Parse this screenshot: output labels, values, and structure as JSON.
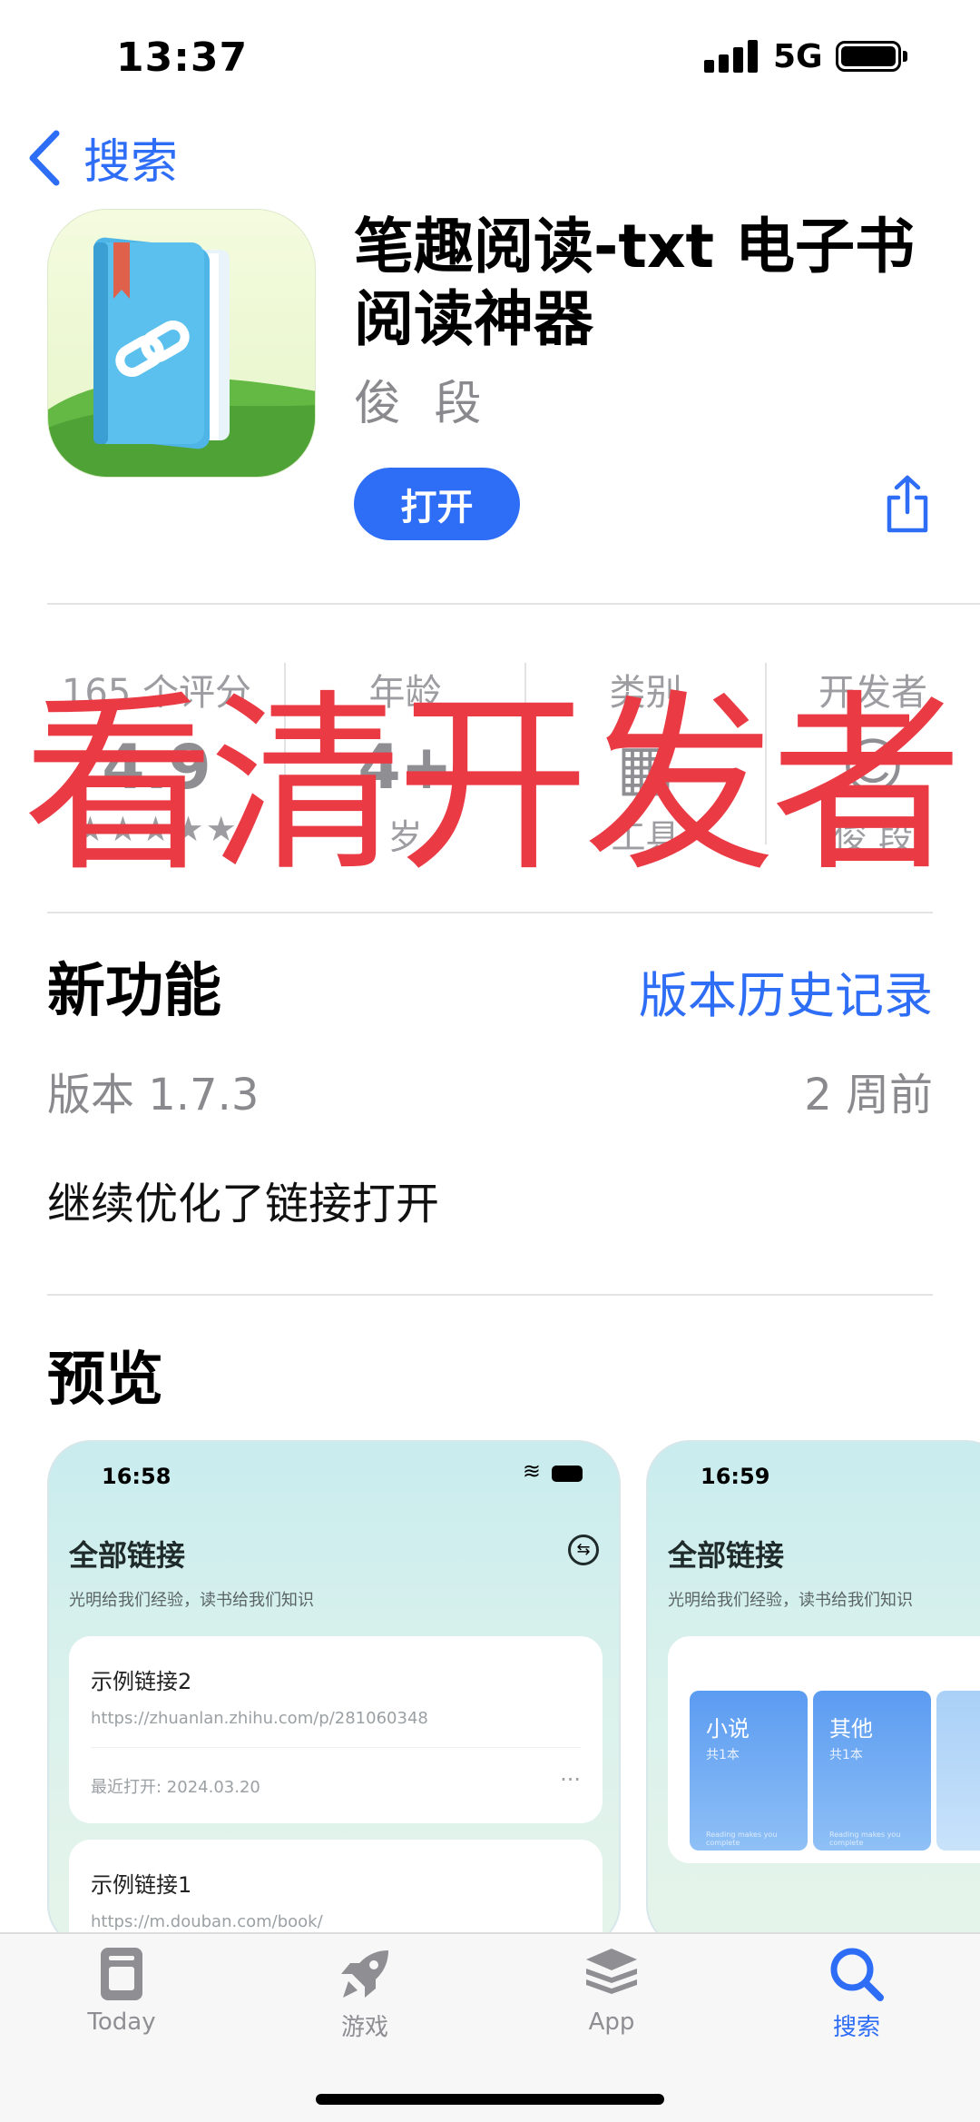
{
  "status_bar": {
    "time": "13:37",
    "network": "5G"
  },
  "nav": {
    "back_label": "搜索"
  },
  "app": {
    "title": "笔趣阅读-txt 电子书阅读神器",
    "developer": "俊 段",
    "open_label": "打开"
  },
  "info": {
    "ratings": {
      "label": "165 个评分",
      "value": "4.9",
      "stars": 5
    },
    "age": {
      "label": "年龄",
      "value": "4+",
      "sub": "岁"
    },
    "category": {
      "label": "类别",
      "sub": "工具"
    },
    "developer": {
      "label": "开发者",
      "sub": "俊 段"
    }
  },
  "watermark_text": "看清开发者",
  "whats_new": {
    "title": "新功能",
    "history_link": "版本历史记录",
    "version": "版本 1.7.3",
    "date": "2 周前",
    "notes": "继续优化了链接打开"
  },
  "preview": {
    "title": "预览",
    "shot1": {
      "time": "16:58",
      "heading": "全部链接",
      "subtitle": "光明给我们经验，读书给我们知识",
      "cards": [
        {
          "title": "示例链接2",
          "url": "https://zhuanlan.zhihu.com/p/281060348",
          "meta": "最近打开: 2024.03.20"
        },
        {
          "title": "示例链接1",
          "url": "https://m.douban.com/book/"
        }
      ]
    },
    "shot2": {
      "time": "16:59",
      "heading": "全部链接",
      "subtitle": "光明给我们经验，读书给我们知识",
      "tiles": [
        {
          "name": "小说",
          "count": "共1本",
          "footer": "Reading makes you complete"
        },
        {
          "name": "其他",
          "count": "共1本",
          "footer": "Reading makes you complete"
        }
      ]
    }
  },
  "tabs": [
    {
      "label": "Today",
      "icon": "today-icon"
    },
    {
      "label": "游戏",
      "icon": "rocket-icon"
    },
    {
      "label": "App",
      "icon": "layers-icon"
    },
    {
      "label": "搜索",
      "icon": "search-icon",
      "active": true
    }
  ],
  "colors": {
    "accent": "#2e6df6",
    "watermark": "#ea3b45"
  }
}
